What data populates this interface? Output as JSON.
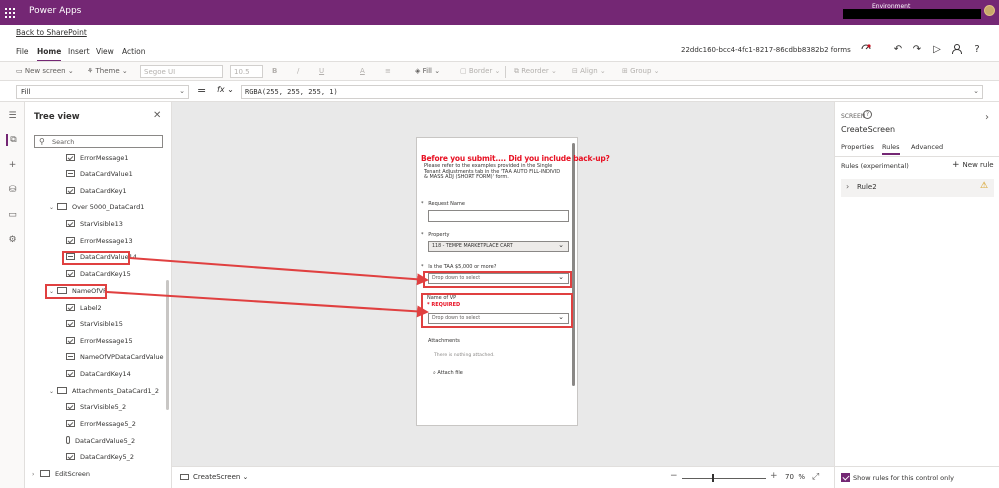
{
  "header": {
    "app_name": "Power Apps",
    "environment_label": "Environment",
    "back_link": "Back to SharePoint"
  },
  "menu": {
    "items": [
      "File",
      "Home",
      "Insert",
      "View",
      "Action"
    ],
    "active": "Home",
    "app_id": "22ddc160-bcc4-4fc1-8217-86cdbb8382b2 forms"
  },
  "ribbon": {
    "new_screen": "New screen",
    "theme": "Theme",
    "font": "Segoe UI",
    "font_size": "10.5",
    "bold": "B",
    "italic": "/",
    "underline": "U",
    "font_color": "A",
    "align": "≡",
    "fill": "Fill",
    "border": "Border",
    "reorder": "Reorder",
    "align_menu": "Align",
    "group": "Group"
  },
  "formula_bar": {
    "property": "Fill",
    "fx": "fx",
    "formula": "RGBA(255, 255, 255, 1)"
  },
  "tree_view": {
    "title": "Tree view",
    "search_placeholder": "Search",
    "nodes": [
      {
        "label": "ErrorMessage1",
        "icon": "check-icon"
      },
      {
        "label": "DataCardValue1",
        "icon": "text-input-icon"
      },
      {
        "label": "DataCardKey1",
        "icon": "check-icon"
      },
      {
        "label": "Over 5000_DataCard1",
        "icon": "card-icon"
      },
      {
        "label": "StarVisible13",
        "icon": "check-icon"
      },
      {
        "label": "ErrorMessage13",
        "icon": "check-icon"
      },
      {
        "label": "DataCardValue14",
        "icon": "text-input-icon"
      },
      {
        "label": "DataCardKey15",
        "icon": "check-icon"
      },
      {
        "label": "NameOfVP",
        "icon": "card-icon"
      },
      {
        "label": "Label2",
        "icon": "check-icon"
      },
      {
        "label": "StarVisible15",
        "icon": "check-icon"
      },
      {
        "label": "ErrorMessage15",
        "icon": "check-icon"
      },
      {
        "label": "NameOfVPDataCardValue",
        "icon": "text-input-icon"
      },
      {
        "label": "DataCardKey14",
        "icon": "check-icon"
      },
      {
        "label": "Attachments_DataCard1_2",
        "icon": "card-icon"
      },
      {
        "label": "StarVisible5_2",
        "icon": "check-icon"
      },
      {
        "label": "ErrorMessage5_2",
        "icon": "check-icon"
      },
      {
        "label": "DataCardValue5_2",
        "icon": "paperclip-icon"
      },
      {
        "label": "DataCardKey5_2",
        "icon": "check-icon"
      },
      {
        "label": "EditScreen",
        "icon": "screen-icon"
      }
    ]
  },
  "form": {
    "warning_title": "Before you submit.... Did you include back-up?",
    "note": "Please refer to the examples provided in the Single Tenant Adjustments tab in the 'TAA AUTO FILL-INDIVID & MASS ADJ (SHORT FORM)' form.",
    "request_name_label": "Request Name",
    "request_name_value": "",
    "property_label": "Property",
    "property_value": "118 - TEMPE MARKETPLACE CART",
    "taa_label": "Is the TAA $5,000 or more?",
    "taa_placeholder": "Drop down to select",
    "vp_label": "Name of VP",
    "required_text": "* REQUIRED",
    "vp_placeholder": "Drop down to select",
    "attachments_label": "Attachments",
    "attachments_empty": "There is nothing attached.",
    "attach_file": "Attach file",
    "star": "*"
  },
  "bottom_bar": {
    "screen": "CreateScreen",
    "zoom": "70",
    "zoom_unit": "%"
  },
  "right_panel": {
    "type_label": "SCREEN",
    "name": "CreateScreen",
    "tabs": [
      "Properties",
      "Rules",
      "Advanced"
    ],
    "active_tab": "Rules",
    "rules_title": "Rules (experimental)",
    "new_rule": "New rule",
    "rule_name": "Rule2",
    "show_rules_label": "Show rules for this control only"
  },
  "colors": {
    "brand": "#742774",
    "highlight": "#e04040",
    "warning_text": "#e81123"
  }
}
